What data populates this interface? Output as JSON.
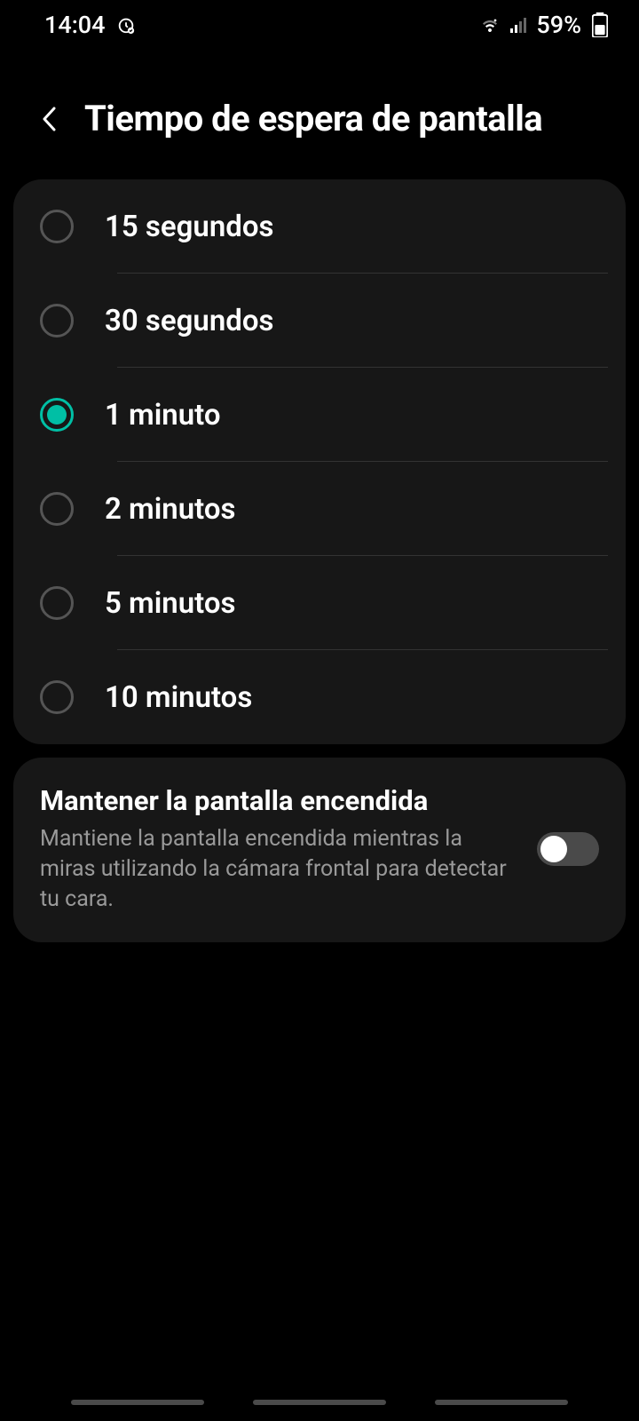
{
  "statusBar": {
    "time": "14:04",
    "battery": "59%"
  },
  "header": {
    "title": "Tiempo de espera de pantalla"
  },
  "timeoutOptions": [
    {
      "label": "15 segundos",
      "selected": false
    },
    {
      "label": "30 segundos",
      "selected": false
    },
    {
      "label": "1 minuto",
      "selected": true
    },
    {
      "label": "2 minutos",
      "selected": false
    },
    {
      "label": "5 minutos",
      "selected": false
    },
    {
      "label": "10 minutos",
      "selected": false
    }
  ],
  "keepScreenOn": {
    "title": "Mantener la pantalla encendida",
    "description": "Mantiene la pantalla encendida mientras la miras utilizando la cámara frontal para detectar tu cara.",
    "enabled": false
  }
}
